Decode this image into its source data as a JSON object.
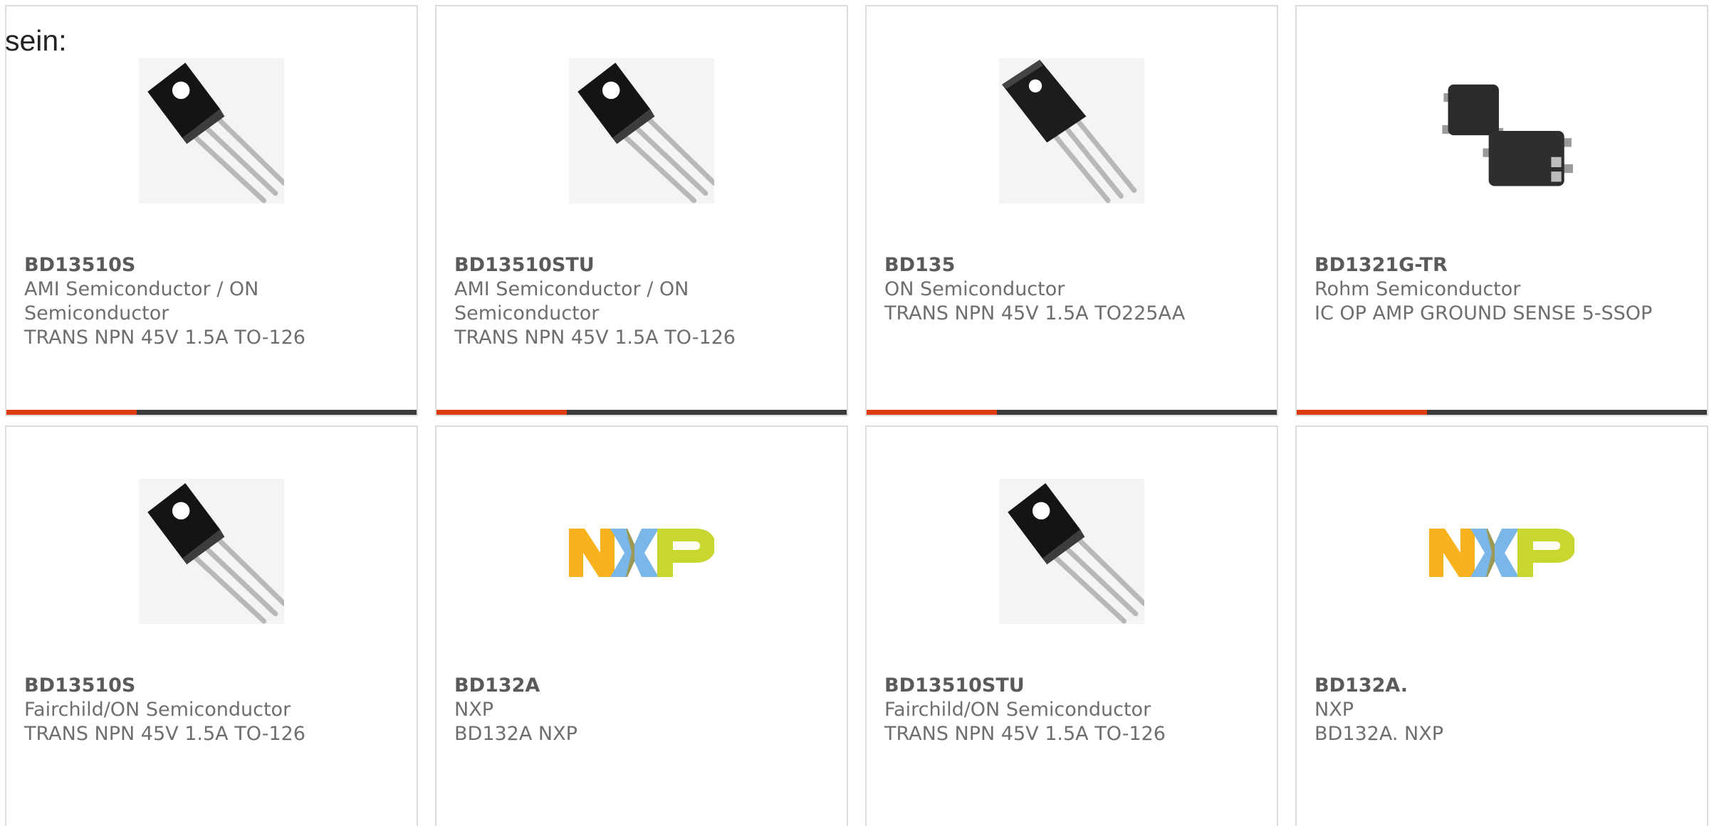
{
  "intro_text": "sein:",
  "colors": {
    "accent": "#dd3b0f",
    "bar": "#3a3a3a",
    "border": "#dcdcdc",
    "text": "#6e6e6e"
  },
  "products": [
    {
      "part_number": "BD13510S",
      "manufacturer": "AMI Semiconductor / ON Semiconductor",
      "description": "TRANS NPN 45V 1.5A TO-126",
      "image": "to126-transistor-icon"
    },
    {
      "part_number": "BD13510STU",
      "manufacturer": "AMI Semiconductor / ON Semiconductor",
      "description": "TRANS NPN 45V 1.5A TO-126",
      "image": "to126-transistor-icon"
    },
    {
      "part_number": "BD135",
      "manufacturer": "ON Semiconductor",
      "description": "TRANS NPN 45V 1.5A TO225AA",
      "image": "to225-transistor-icon"
    },
    {
      "part_number": "BD1321G-TR",
      "manufacturer": "Rohm Semiconductor",
      "description": "IC OP AMP GROUND SENSE 5-SSOP",
      "image": "ssop-chip-icon"
    },
    {
      "part_number": "BD13510S",
      "manufacturer": "Fairchild/ON Semiconductor",
      "description": "TRANS NPN 45V 1.5A TO-126",
      "image": "to126-transistor-icon"
    },
    {
      "part_number": "BD132A",
      "manufacturer": "NXP",
      "description": "BD132A NXP",
      "image": "nxp-logo"
    },
    {
      "part_number": "BD13510STU",
      "manufacturer": "Fairchild/ON Semiconductor",
      "description": "TRANS NPN 45V 1.5A TO-126",
      "image": "to126-transistor-icon"
    },
    {
      "part_number": "BD132A.",
      "manufacturer": "NXP",
      "description": "BD132A. NXP",
      "image": "nxp-logo"
    }
  ]
}
